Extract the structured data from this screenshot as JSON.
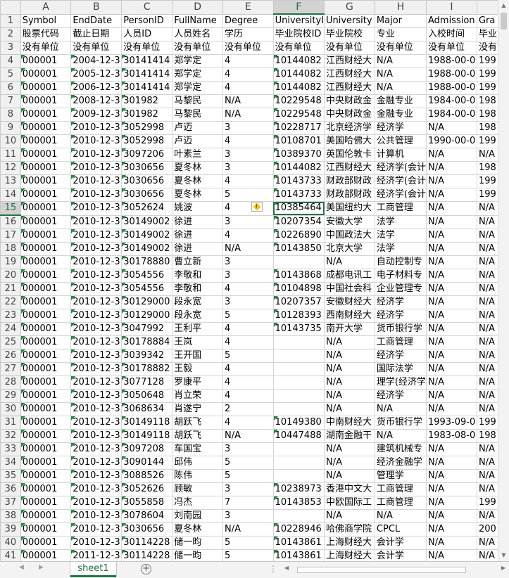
{
  "columns": [
    "A",
    "B",
    "C",
    "D",
    "E",
    "F",
    "G",
    "H",
    "I",
    ""
  ],
  "rows": [
    [
      "Symbol",
      "EndDate",
      "PersonID",
      "FullName",
      "Degree",
      "UniversityI",
      "University",
      "Major",
      "Admission",
      "Gra"
    ],
    [
      "股票代码",
      "截止日期",
      "人员ID",
      "人员姓名",
      "学历",
      "毕业院校ID",
      "毕业院校",
      "专业",
      "入校时间",
      "毕业"
    ],
    [
      "没有单位",
      "没有单位",
      "没有单位",
      "没有单位",
      "没有单位",
      "没有单位",
      "没有单位",
      "没有单位",
      "没有单位",
      "没有"
    ],
    [
      "000001",
      "2004-12-3",
      "30141414",
      "郑学定",
      "4",
      "10144082",
      "江西财经大",
      "N/A",
      "1988-00-0",
      "199"
    ],
    [
      "000001",
      "2005-12-3",
      "30141414",
      "郑学定",
      "4",
      "10144082",
      "江西财经大",
      "N/A",
      "1988-00-0",
      "199"
    ],
    [
      "000001",
      "2006-12-3",
      "30141414",
      "郑学定",
      "4",
      "10144082",
      "江西财经大",
      "N/A",
      "1988-00-0",
      "199"
    ],
    [
      "000001",
      "2008-12-3",
      "301982",
      "马黎民",
      "N/A",
      "10229548",
      "中央财政金",
      "金融专业",
      "1984-00-0",
      "198"
    ],
    [
      "000001",
      "2009-12-3",
      "301982",
      "马黎民",
      "N/A",
      "10229548",
      "中央财政金",
      "金融专业",
      "1984-00-0",
      "198"
    ],
    [
      "000001",
      "2010-12-3",
      "3052998",
      "卢迈",
      "3",
      "10228717",
      "北京经济学",
      "经济学",
      "N/A",
      "198"
    ],
    [
      "000001",
      "2010-12-3",
      "3052998",
      "卢迈",
      "4",
      "10108701",
      "美国哈佛大",
      "公共管理",
      "1990-00-0",
      "199"
    ],
    [
      "000001",
      "2010-12-3",
      "3097206",
      "叶素兰",
      "3",
      "10389370",
      "英国伦敦卡",
      "计算机",
      "N/A",
      "N/A"
    ],
    [
      "000001",
      "2010-12-3",
      "3030656",
      "夏冬林",
      "3",
      "10144082",
      "江西财经大",
      "经济学(会计",
      "N/A",
      "198"
    ],
    [
      "000001",
      "2010-12-3",
      "3030656",
      "夏冬林",
      "4",
      "10143733",
      "财政部财政",
      "经济学(会计",
      "N/A",
      "199"
    ],
    [
      "000001",
      "2010-12-3",
      "3030656",
      "夏冬林",
      "5",
      "10143733",
      "财政部财政",
      "经济学(会计",
      "N/A",
      "199"
    ],
    [
      "000001",
      "2010-12-3",
      "3052624",
      "姚波",
      "4",
      "10385464",
      "美国纽约大",
      "工商管理",
      "N/A",
      "N/A"
    ],
    [
      "000001",
      "2010-12-3",
      "30149002",
      "徐进",
      "3",
      "10207354",
      "安徽大学",
      "法学",
      "N/A",
      "N/A"
    ],
    [
      "000001",
      "2010-12-3",
      "30149002",
      "徐进",
      "4",
      "10226890",
      "中国政法大",
      "法学",
      "N/A",
      "N/A"
    ],
    [
      "000001",
      "2010-12-3",
      "30149002",
      "徐进",
      "N/A",
      "10143850",
      "北京大学",
      "法学",
      "N/A",
      "N/A"
    ],
    [
      "000001",
      "2010-12-3",
      "30178880",
      "曹立新",
      "3",
      "",
      "N/A",
      "自动控制专",
      "N/A",
      "N/A"
    ],
    [
      "000001",
      "2010-12-3",
      "3054556",
      "李敬和",
      "3",
      "10143868",
      "成都电讯工",
      "电子材料专",
      "N/A",
      "N/A"
    ],
    [
      "000001",
      "2010-12-3",
      "3054556",
      "李敬和",
      "4",
      "10104898",
      "中国社会科",
      "企业管理专",
      "N/A",
      "N/A"
    ],
    [
      "000001",
      "2010-12-3",
      "30129000",
      "段永宽",
      "3",
      "10207357",
      "安徽财经大",
      "经济学",
      "N/A",
      "N/A"
    ],
    [
      "000001",
      "2010-12-3",
      "30129000",
      "段永宽",
      "5",
      "10128393",
      "西南财经大",
      "经济学",
      "N/A",
      "N/A"
    ],
    [
      "000001",
      "2010-12-3",
      "3047992",
      "王利平",
      "4",
      "10143735",
      "南开大学",
      "货币银行学",
      "N/A",
      "N/A"
    ],
    [
      "000001",
      "2010-12-3",
      "30178884",
      "王岚",
      "4",
      "",
      "N/A",
      "工商管理",
      "N/A",
      "N/A"
    ],
    [
      "000001",
      "2010-12-3",
      "3039342",
      "王开国",
      "5",
      "",
      "N/A",
      "经济学",
      "N/A",
      "N/A"
    ],
    [
      "000001",
      "2010-12-3",
      "30178882",
      "王毅",
      "4",
      "",
      "N/A",
      "国际法学",
      "N/A",
      "N/A"
    ],
    [
      "000001",
      "2010-12-3",
      "3077128",
      "罗康平",
      "4",
      "",
      "N/A",
      "理学(经济学",
      "N/A",
      "N/A"
    ],
    [
      "000001",
      "2010-12-3",
      "3050648",
      "肖立荣",
      "4",
      "",
      "N/A",
      "经济学",
      "N/A",
      "N/A"
    ],
    [
      "000001",
      "2010-12-3",
      "3068634",
      "肖遂宁",
      "2",
      "",
      "N/A",
      "N/A",
      "N/A",
      "N/A"
    ],
    [
      "000001",
      "2010-12-3",
      "30149118",
      "胡跃飞",
      "4",
      "10149380",
      "中南财经大",
      "货币银行学",
      "1993-09-0",
      "199"
    ],
    [
      "000001",
      "2010-12-3",
      "30149118",
      "胡跃飞",
      "N/A",
      "10447488",
      "湖南金融干",
      "N/A",
      "1983-08-0",
      "198"
    ],
    [
      "000001",
      "2010-12-3",
      "3097208",
      "车国宝",
      "3",
      "",
      "N/A",
      "建筑机械专",
      "N/A",
      "N/A"
    ],
    [
      "000001",
      "2010-12-3",
      "3090144",
      "邱伟",
      "5",
      "",
      "N/A",
      "经济金融学",
      "N/A",
      "N/A"
    ],
    [
      "000001",
      "2010-12-3",
      "3088526",
      "陈伟",
      "5",
      "",
      "N/A",
      "管理学",
      "N/A",
      "N/A"
    ],
    [
      "000001",
      "2010-12-3",
      "3052626",
      "顾敏",
      "3",
      "10238973",
      "香港中文大",
      "工商管理",
      "N/A",
      "N/A"
    ],
    [
      "000001",
      "2010-12-3",
      "3055858",
      "冯杰",
      "7",
      "10143853",
      "中欧国际工",
      "工商管理",
      "N/A",
      "199"
    ],
    [
      "000001",
      "2010-12-3",
      "3078604",
      "刘南园",
      "3",
      "",
      "N/A",
      "N/A",
      "N/A",
      "N/A"
    ],
    [
      "000001",
      "2010-12-3",
      "3030656",
      "夏冬林",
      "N/A",
      "10228946",
      "哈佛商学院",
      "CPCL",
      "N/A",
      "200"
    ],
    [
      "000001",
      "2010-12-3",
      "30114228",
      "储一昀",
      "5",
      "10143861",
      "上海财经大",
      "会计学",
      "N/A",
      "N/A"
    ],
    [
      "000001",
      "2011-12-3",
      "30114228",
      "储一昀",
      "5",
      "10143861",
      "上海财经大",
      "会计学",
      "N/A",
      "N/A"
    ]
  ],
  "sheet_tab": "sheet1",
  "add_sheet_symbol": "+",
  "warning_symbol": "!",
  "nav_prev": "◀",
  "nav_next": "▶",
  "tab_dots": "⋮",
  "active_cell": "F15",
  "colors": {
    "accent": "#217346",
    "triangle": "#1f8a3c",
    "header_bg": "#f0f0f0"
  },
  "icons": [
    "warning-icon",
    "add-sheet-icon",
    "sheet-nav-prev-icon",
    "sheet-nav-next-icon"
  ]
}
